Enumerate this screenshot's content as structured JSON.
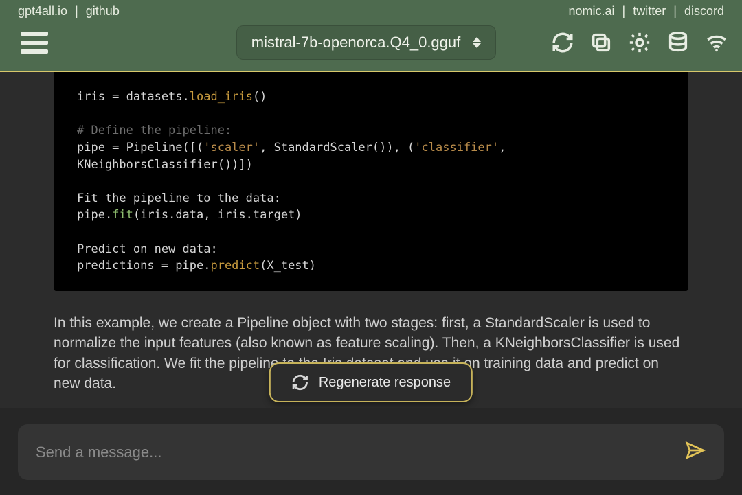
{
  "header": {
    "links_left": [
      "gpt4all.io",
      "github"
    ],
    "links_right": [
      "nomic.ai",
      "twitter",
      "discord"
    ],
    "model_label": "mistral-7b-openorca.Q4_0.gguf"
  },
  "code": {
    "l1a": "iris = datasets.",
    "l1b": "load_iris",
    "l1c": "()",
    "l2": "# Define the pipeline:",
    "l3a": "pipe = Pipeline([(",
    "l3b": "'scaler'",
    "l3c": ", StandardScaler()), (",
    "l3d": "'classifier'",
    "l3e": ",",
    "l4": "KNeighborsClassifier())])",
    "l5": "Fit the pipeline to the data:",
    "l6a": "pipe.",
    "l6b": "fit",
    "l6c": "(iris.data, iris.target)",
    "l7": "Predict on new data:",
    "l8a": "predictions = pipe.",
    "l8b": "predict",
    "l8c": "(X_test)"
  },
  "explain": "In this example, we create a Pipeline object with two stages: first, a StandardScaler is used to normalize the input features (also known as feature scaling). Then, a KNeighborsClassifier is used for classification. We fit the pipeline to the Iris dataset and use it on training data and predict on new data.",
  "regen_label": "Regenerate response",
  "input_placeholder": "Send a message..."
}
